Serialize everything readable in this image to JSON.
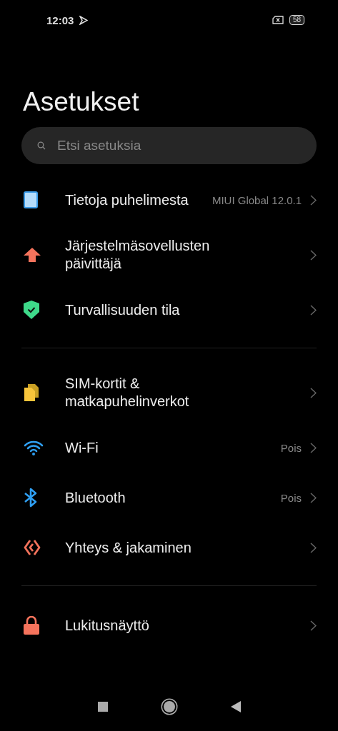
{
  "status_bar": {
    "time": "12:03",
    "battery": "58"
  },
  "title": "Asetukset",
  "search": {
    "placeholder": "Etsi asetuksia"
  },
  "sections": [
    {
      "items": [
        {
          "kind": "phone",
          "label": "Tietoja puhelimesta",
          "value": "MIUI Global 12.0.1"
        },
        {
          "kind": "update",
          "label": "Järjestelmäsovellusten päivittäjä"
        },
        {
          "kind": "shield",
          "label": "Turvallisuuden tila"
        }
      ]
    },
    {
      "items": [
        {
          "kind": "sim",
          "label": "SIM-kortit & matkapuhelinverkot"
        },
        {
          "kind": "wifi",
          "label": "Wi-Fi",
          "value": "Pois"
        },
        {
          "kind": "bluetooth",
          "label": "Bluetooth",
          "value": "Pois"
        },
        {
          "kind": "share",
          "label": "Yhteys & jakaminen"
        }
      ]
    },
    {
      "items": [
        {
          "kind": "lock",
          "label": "Lukitusnäyttö"
        }
      ]
    }
  ]
}
